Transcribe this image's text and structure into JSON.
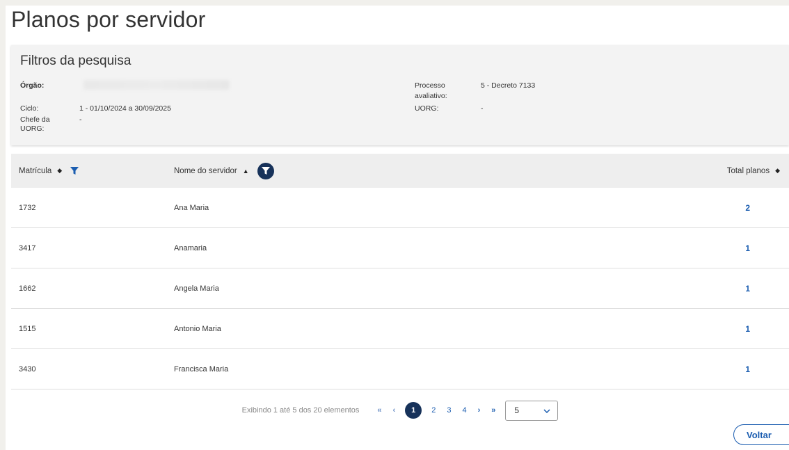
{
  "page": {
    "title": "Planos por servidor"
  },
  "filters": {
    "title": "Filtros da pesquisa",
    "orgao_label": "Órgão:",
    "ciclo_label": "Ciclo:",
    "ciclo_value": "1 - 01/10/2024 a 30/09/2025",
    "chefe_label_1": "Chefe da",
    "chefe_label_2": "UORG:",
    "chefe_value": "-",
    "processo_label_1": "Processo",
    "processo_label_2": "avaliativo:",
    "processo_value": "5 - Decreto 7133",
    "uorg_label": "UORG:",
    "uorg_value": "-"
  },
  "table": {
    "headers": {
      "matricula": "Matrícula",
      "nome": "Nome do servidor",
      "total": "Total planos"
    },
    "rows": [
      {
        "matricula": "1732",
        "nome": "Ana Maria",
        "total": "2"
      },
      {
        "matricula": "3417",
        "nome": "Anamaria",
        "total": "1"
      },
      {
        "matricula": "1662",
        "nome": "Angela Maria",
        "total": "1"
      },
      {
        "matricula": "1515",
        "nome": "Antonio Maria",
        "total": "1"
      },
      {
        "matricula": "3430",
        "nome": "Francisca Maria",
        "total": "1"
      }
    ]
  },
  "pagination": {
    "info": "Exibindo 1 até 5 dos 20 elementos",
    "first": "«",
    "prev": "‹",
    "pages": [
      "1",
      "2",
      "3",
      "4"
    ],
    "next": "›",
    "last": "»",
    "page_size": "5"
  },
  "actions": {
    "back_label": "Voltar"
  },
  "colors": {
    "accent": "#1b5db0",
    "dark_accent": "#17325a"
  },
  "icons": [
    "sort-icon",
    "filter-icon",
    "chevron-down-icon"
  ]
}
